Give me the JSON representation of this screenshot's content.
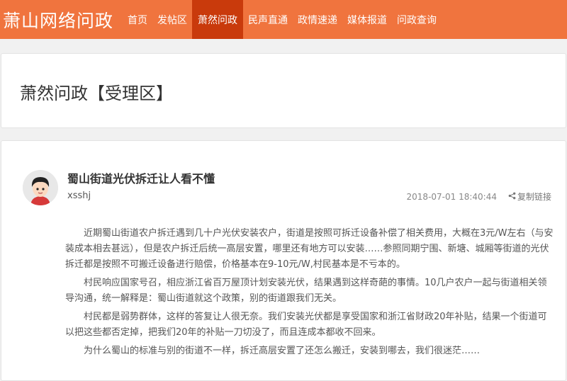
{
  "header": {
    "logo": "萧山网络问政",
    "nav": [
      {
        "label": "首页"
      },
      {
        "label": "发帖区"
      },
      {
        "label": "萧然问政",
        "active": true
      },
      {
        "label": "民声直通"
      },
      {
        "label": "政情速递"
      },
      {
        "label": "媒体报道"
      },
      {
        "label": "问政查询"
      }
    ],
    "bg_color": "#f0743e",
    "active_color": "#c93a0c"
  },
  "section": {
    "title": "萧然问政【受理区】"
  },
  "post": {
    "title": "蜀山街道光伏拆迁让人看不懂",
    "author": "xsshj",
    "date": "2018-07-01 18:40:44",
    "copy_link": "复制链接",
    "avatar_icon": "user-avatar-icon",
    "paragraphs": [
      "近期蜀山街道农户拆迁遇到几十户光伏安装农户，街道是按照可拆迁设备补偿了相关费用，大概在3元/W左右（与安装成本相去甚远），但是农户拆迁后统一高层安置，哪里还有地方可以安装……参照同期宁围、新塘、城厢等街道的光伏拆迁都是按照不可搬迁设备进行赔偿，价格基本在9-10元/W,村民基本是不亏本的。",
      "村民响应国家号召，相应浙江省百万屋顶计划安装光伏，结果遇到这样奇葩的事情。10几户农户一起与街道相关领导沟通，统一解释是：蜀山街道就这个政策，别的街道跟我们无关。",
      "村民都是弱势群体，这样的答复让人很无奈。我们安装光伏都是享受国家和浙江省财政20年补贴，结果一个街道可以把这些都否定掉，把我们20年的补贴一刀切没了，而且连成本都收不回来。",
      "为什么蜀山的标准与别的街道不一样，拆迁高层安置了还怎么搬迁，安装到哪去，我们很迷茫……"
    ]
  }
}
